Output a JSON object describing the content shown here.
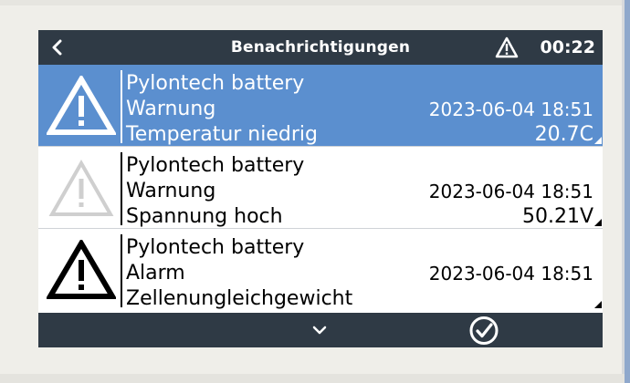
{
  "header": {
    "title": "Benachrichtigungen",
    "time": "00:22",
    "back_icon": "chevron-left-icon",
    "status_icon": "warning-triangle-icon"
  },
  "notifications": [
    {
      "device": "Pylontech battery",
      "type": "Warnung",
      "timestamp": "2023-06-04 18:51",
      "description": "Temperatur niedrig",
      "value": "20.7C",
      "icon": "warning-triangle-icon",
      "selected": true
    },
    {
      "device": "Pylontech battery",
      "type": "Warnung",
      "timestamp": "2023-06-04 18:51",
      "description": "Spannung hoch",
      "value": "50.21V",
      "icon": "warning-triangle-inactive-icon",
      "selected": false
    },
    {
      "device": "Pylontech battery",
      "type": "Alarm",
      "timestamp": "2023-06-04 18:51",
      "description": "Zellenungleichgewicht",
      "value": "",
      "icon": "alarm-triangle-icon",
      "selected": false
    }
  ],
  "footer": {
    "down_icon": "chevron-down-icon",
    "confirm_icon": "check-circle-icon"
  },
  "colors": {
    "titlebar": "#2f3a45",
    "selected_row": "#5b8fcf",
    "inactive_icon": "#cfcfcf",
    "background": "#efeee9"
  }
}
